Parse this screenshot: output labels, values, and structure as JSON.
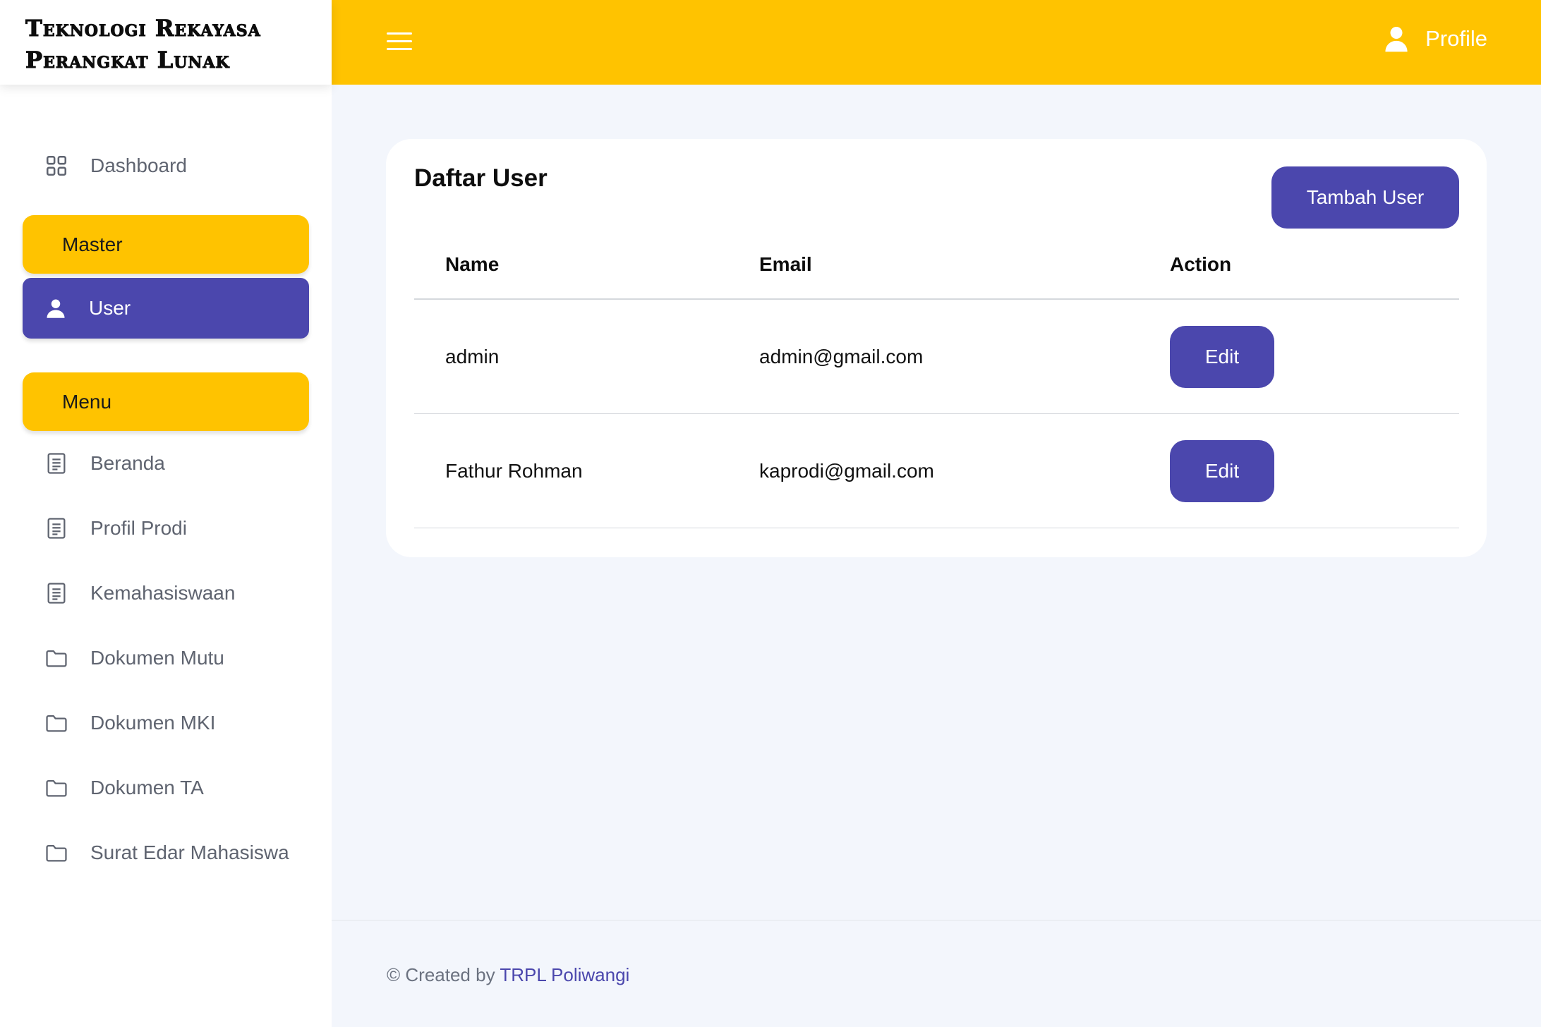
{
  "brand": {
    "line1": "Teknologi Rekayasa",
    "line2": "Perangkat Lunak"
  },
  "topbar": {
    "menu_icon": "hamburger-icon",
    "profile_label": "Profile",
    "profile_icon": "user-icon"
  },
  "sidebar": {
    "dashboard": {
      "label": "Dashboard",
      "icon": "grid-icon"
    },
    "master_section": "Master",
    "active_item": {
      "label": "User",
      "icon": "user-icon"
    },
    "menu_section": "Menu",
    "items": [
      {
        "label": "Beranda",
        "icon": "document-icon"
      },
      {
        "label": "Profil Prodi",
        "icon": "document-icon"
      },
      {
        "label": "Kemahasiswaan",
        "icon": "document-icon"
      },
      {
        "label": "Dokumen Mutu",
        "icon": "folder-icon"
      },
      {
        "label": "Dokumen MKI",
        "icon": "folder-icon"
      },
      {
        "label": "Dokumen TA",
        "icon": "folder-icon"
      },
      {
        "label": "Surat Edar Mahasiswa",
        "icon": "folder-icon"
      }
    ]
  },
  "card": {
    "title": "Daftar User",
    "add_button": "Tambah User",
    "columns": [
      "Name",
      "Email",
      "Action"
    ],
    "rows": [
      {
        "name": "admin",
        "email": "admin@gmail.com",
        "action": "Edit"
      },
      {
        "name": "Fathur Rohman",
        "email": "kaprodi@gmail.com",
        "action": "Edit"
      }
    ]
  },
  "footer": {
    "prefix": "© Created by",
    "link": "TRPL Poliwangi"
  },
  "colors": {
    "accent_yellow": "#ffc300",
    "accent_purple": "#4b47ad",
    "background": "#f3f6fc"
  }
}
